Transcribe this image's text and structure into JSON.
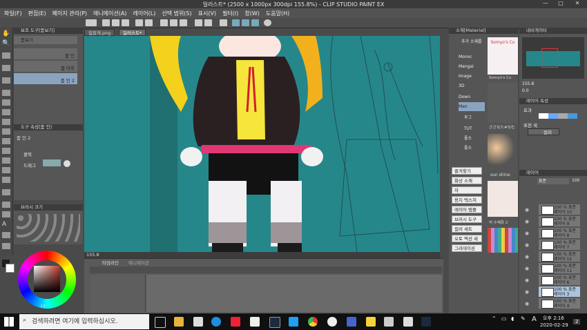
{
  "window": {
    "title": "일러스트* (2500 x 1000px 300dpi 155.8%) - CLIP STUDIO PAINT EX",
    "minimize": "—",
    "maximize": "□",
    "close": "✕"
  },
  "menu": [
    "파일(F)",
    "편집(E)",
    "페이지 관리(P)",
    "애니메이션(A)",
    "레이어(L)",
    "선택 범위(S)",
    "표시(V)",
    "필터(I)",
    "창(W)",
    "도움말(H)"
  ],
  "subtool_panel": {
    "title": "보조 도구[돋보기]",
    "items": [
      {
        "label": "돋보기",
        "selected": true
      },
      {
        "label": "줌 인",
        "selected": false
      },
      {
        "label": "줌 아웃",
        "selected": false
      },
      {
        "label": "줌 인 2",
        "selected": true
      }
    ]
  },
  "tool_property": {
    "title": "도구 속성[줌 인]",
    "name": "줌 인 2",
    "rows": [
      "클릭",
      "드래그"
    ]
  },
  "brush_size": {
    "title": "브러시 크기"
  },
  "canvas_tabs": [
    "힘들게.png",
    "일러스트*"
  ],
  "canvas_status": {
    "zoom": "155.8"
  },
  "timeline": {
    "tabs": [
      "타임라인",
      "애니메이션"
    ]
  },
  "material_panel": {
    "title": "소재[Material]",
    "search_label": "추가 소재를",
    "tree": [
      "Monoc",
      "Mangai",
      "Image",
      "3D",
      "Down",
      "Man",
      "후그",
      "TUT",
      "좋소",
      "좋소"
    ],
    "keywords": [
      "즐겨찾기",
      "화상 소재",
      "자",
      "용지 텍스처",
      "레이어 템플",
      "브러시 도구",
      "컬러 세트",
      "오토 액션 세",
      "그라데이션"
    ],
    "thumbs": [
      {
        "label": "Somyo's Cu",
        "caption": "Somyo's Cu"
      },
      {
        "label": "",
        "caption": "ささなた#なむ"
      },
      {
        "label": "",
        "caption": "sun shine"
      },
      {
        "label": "",
        "caption": "처 수채화 2"
      }
    ]
  },
  "navigator": {
    "title": "내비게이터",
    "zoom": "155.8",
    "angle": "0.0"
  },
  "layer_property": {
    "title": "레이어 속성",
    "effect_label": "효과",
    "expression_label": "표현 색",
    "expression_value": "컬러"
  },
  "layer_panel": {
    "title": "레이어",
    "blend": "표준",
    "opacity": "100",
    "layers": [
      {
        "pct": "100 % 표준",
        "name": "레이어 10",
        "selected": false
      },
      {
        "pct": "100 % 표준",
        "name": "레이어 9",
        "selected": false
      },
      {
        "pct": "100 % 표준",
        "name": "레이어 8",
        "selected": false
      },
      {
        "pct": "100 % 표준",
        "name": "레이어 7",
        "selected": false
      },
      {
        "pct": "100 % 표준",
        "name": "레이어 12",
        "selected": false
      },
      {
        "pct": "100 % 표준",
        "name": "레이어 11",
        "selected": false
      },
      {
        "pct": "100 % 표준",
        "name": "레이어 6",
        "selected": false
      },
      {
        "pct": "100 % 표준",
        "name": "레이어 3",
        "selected": true
      },
      {
        "pct": "100 % 표준",
        "name": "레이어 4",
        "selected": false
      }
    ]
  },
  "color": {
    "main": "#1e1e1e",
    "sub": "#ffffff",
    "wheel_value": "14"
  },
  "taskbar": {
    "search_placeholder": "검색하려면 여기에 입력하십시오.",
    "time": "오후 2:16",
    "date": "2020-02-29",
    "ime": "A",
    "notif": "2"
  }
}
